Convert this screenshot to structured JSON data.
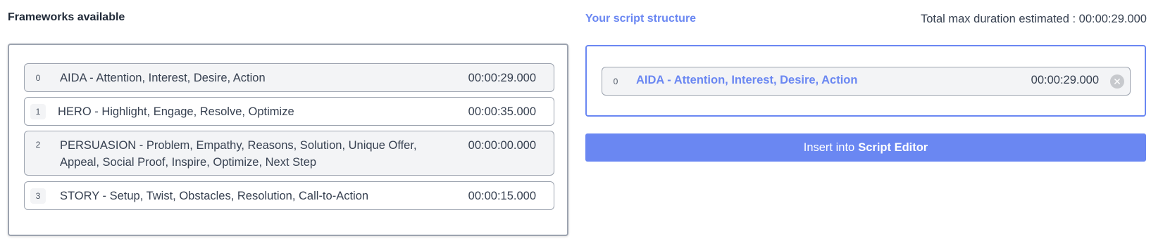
{
  "left": {
    "title": "Frameworks available",
    "frameworks": [
      {
        "index": "0",
        "name": "AIDA - Attention, Interest, Desire, Action",
        "duration": "00:00:29.000"
      },
      {
        "index": "1",
        "name": "HERO - Highlight, Engage, Resolve, Optimize",
        "duration": "00:00:35.000"
      },
      {
        "index": "2",
        "name": "PERSUASION - Problem, Empathy, Reasons, Solution, Unique Offer,",
        "name_line2": "Appeal, Social Proof, Inspire, Optimize, Next Step",
        "duration": "00:00:00.000"
      },
      {
        "index": "3",
        "name": "STORY - Setup, Twist, Obstacles, Resolution, Call-to-Action",
        "duration": "00:00:15.000"
      }
    ]
  },
  "right": {
    "title": "Your script structure",
    "total_label": "Total max duration estimated : 00:00:29.000",
    "selected": [
      {
        "index": "0",
        "name": "AIDA - Attention, Interest, Desire, Action",
        "duration": "00:00:29.000",
        "remove_icon": "close-circle-icon"
      }
    ],
    "insert_prefix": "Insert into",
    "insert_bold": "Script Editor"
  },
  "colors": {
    "accent": "#6a87f2",
    "border": "#9ca3af",
    "item_bg": "#f3f4f6"
  }
}
